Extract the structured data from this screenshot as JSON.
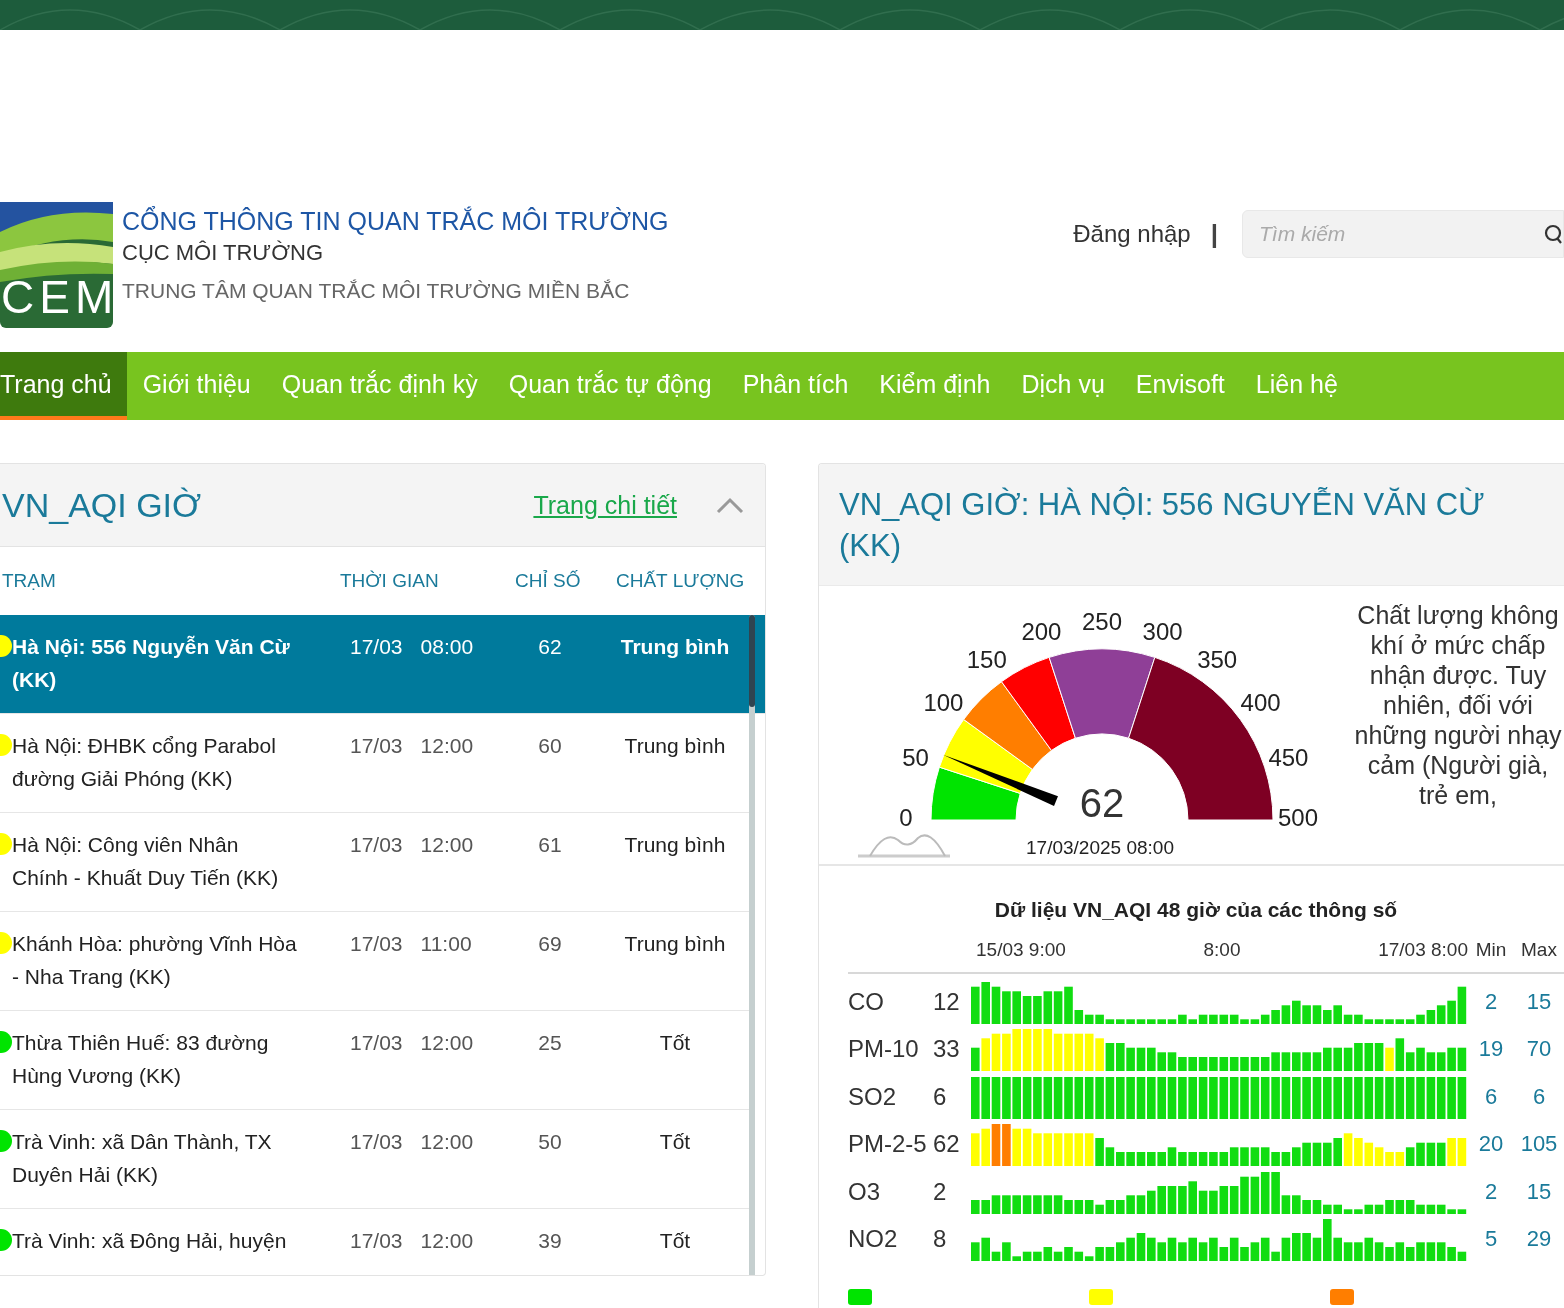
{
  "header": {
    "logo_text": "CEM",
    "title": "CỔNG THÔNG TIN QUAN TRẮC MÔI TRƯỜNG",
    "subtitle": "CỤC MÔI TRƯỜNG",
    "org": "TRUNG TÂM QUAN TRẮC MÔI TRƯỜNG MIỀN BẮC",
    "login": "Đăng nhập",
    "separator": "|",
    "search": {
      "placeholder": "Tìm kiếm"
    }
  },
  "nav": [
    {
      "label": "Trang chủ",
      "selected": true
    },
    {
      "label": "Giới thiệu",
      "selected": false
    },
    {
      "label": "Quan trắc định kỳ",
      "selected": false
    },
    {
      "label": "Quan trắc tự động",
      "selected": false
    },
    {
      "label": "Phân tích",
      "selected": false
    },
    {
      "label": "Kiểm định",
      "selected": false
    },
    {
      "label": "Dịch vụ",
      "selected": false
    },
    {
      "label": "Envisoft",
      "selected": false
    },
    {
      "label": "Liên hệ",
      "selected": false
    }
  ],
  "aqi_list": {
    "title": "VN_AQI GIỜ",
    "detail_link": "Trang chi tiết",
    "columns": [
      "TRẠM",
      "THỜI GIAN",
      "CHỈ SỐ",
      "CHẤT LƯỢNG"
    ],
    "rows": [
      {
        "station": "Hà Nội: 556 Nguyễn Văn Cừ (KK)",
        "date": "17/03",
        "time": "08:00",
        "index": "62",
        "quality": "Trung bình",
        "color": "#ffff00",
        "selected": true
      },
      {
        "station": "Hà Nội: ĐHBK cổng Parabol đường Giải Phóng (KK)",
        "date": "17/03",
        "time": "12:00",
        "index": "60",
        "quality": "Trung bình",
        "color": "#ffff00",
        "selected": false
      },
      {
        "station": "Hà Nội: Công viên Nhân Chính - Khuất Duy Tiến (KK)",
        "date": "17/03",
        "time": "12:00",
        "index": "61",
        "quality": "Trung bình",
        "color": "#ffff00",
        "selected": false
      },
      {
        "station": "Khánh Hòa: phường Vĩnh Hòa - Nha Trang (KK)",
        "date": "17/03",
        "time": "11:00",
        "index": "69",
        "quality": "Trung bình",
        "color": "#ffff00",
        "selected": false
      },
      {
        "station": "Thừa Thiên Huế: 83 đường Hùng Vương (KK)",
        "date": "17/03",
        "time": "12:00",
        "index": "25",
        "quality": "Tốt",
        "color": "#00e400",
        "selected": false
      },
      {
        "station": "Trà Vinh: xã Dân Thành, TX Duyên Hải (KK)",
        "date": "17/03",
        "time": "12:00",
        "index": "50",
        "quality": "Tốt",
        "color": "#00e400",
        "selected": false
      },
      {
        "station": "Trà Vinh: xã Đông Hải, huyện",
        "date": "17/03",
        "time": "12:00",
        "index": "39",
        "quality": "Tốt",
        "color": "#00e400",
        "selected": false
      }
    ]
  },
  "station_detail": {
    "title": "VN_AQI GIỜ: HÀ NỘI: 556 NGUYỄN VĂN CỪ (KK)",
    "gauge": {
      "scale": [
        "0",
        "50",
        "100",
        "150",
        "200",
        "250",
        "300",
        "350",
        "400",
        "450",
        "500"
      ],
      "segments": [
        {
          "color": "#00e400"
        },
        {
          "color": "#ffff00"
        },
        {
          "color": "#ff7e00"
        },
        {
          "color": "#ff0000"
        },
        {
          "color": "#8f3f97"
        },
        {
          "color": "#7e0023"
        }
      ],
      "value": "62",
      "timestamp": "17/03/2025 08:00"
    },
    "description": "Chất lượng không khí ở mức chấp nhận được. Tuy nhiên, đối với những người nhạy cảm (Người già, trẻ em,",
    "params": {
      "title": "Dữ liệu VN_AQI 48 giờ của các thông số",
      "time_labels": [
        "15/03 9:00",
        "8:00",
        "17/03 8:00"
      ],
      "min_label": "Min",
      "max_label": "Max",
      "rows": [
        {
          "name": "CO",
          "value": "12",
          "min": "2",
          "max": "15"
        },
        {
          "name": "PM-10",
          "value": "33",
          "min": "19",
          "max": "70"
        },
        {
          "name": "SO2",
          "value": "6",
          "min": "6",
          "max": "6"
        },
        {
          "name": "PM-2-5",
          "value": "62",
          "min": "20",
          "max": "105"
        },
        {
          "name": "O3",
          "value": "2",
          "min": "2",
          "max": "15"
        },
        {
          "name": "NO2",
          "value": "8",
          "min": "5",
          "max": "29"
        }
      ]
    },
    "legend": [
      {
        "color": "#00e400"
      },
      {
        "color": "#ffff00"
      },
      {
        "color": "#ff7e00"
      }
    ]
  }
}
